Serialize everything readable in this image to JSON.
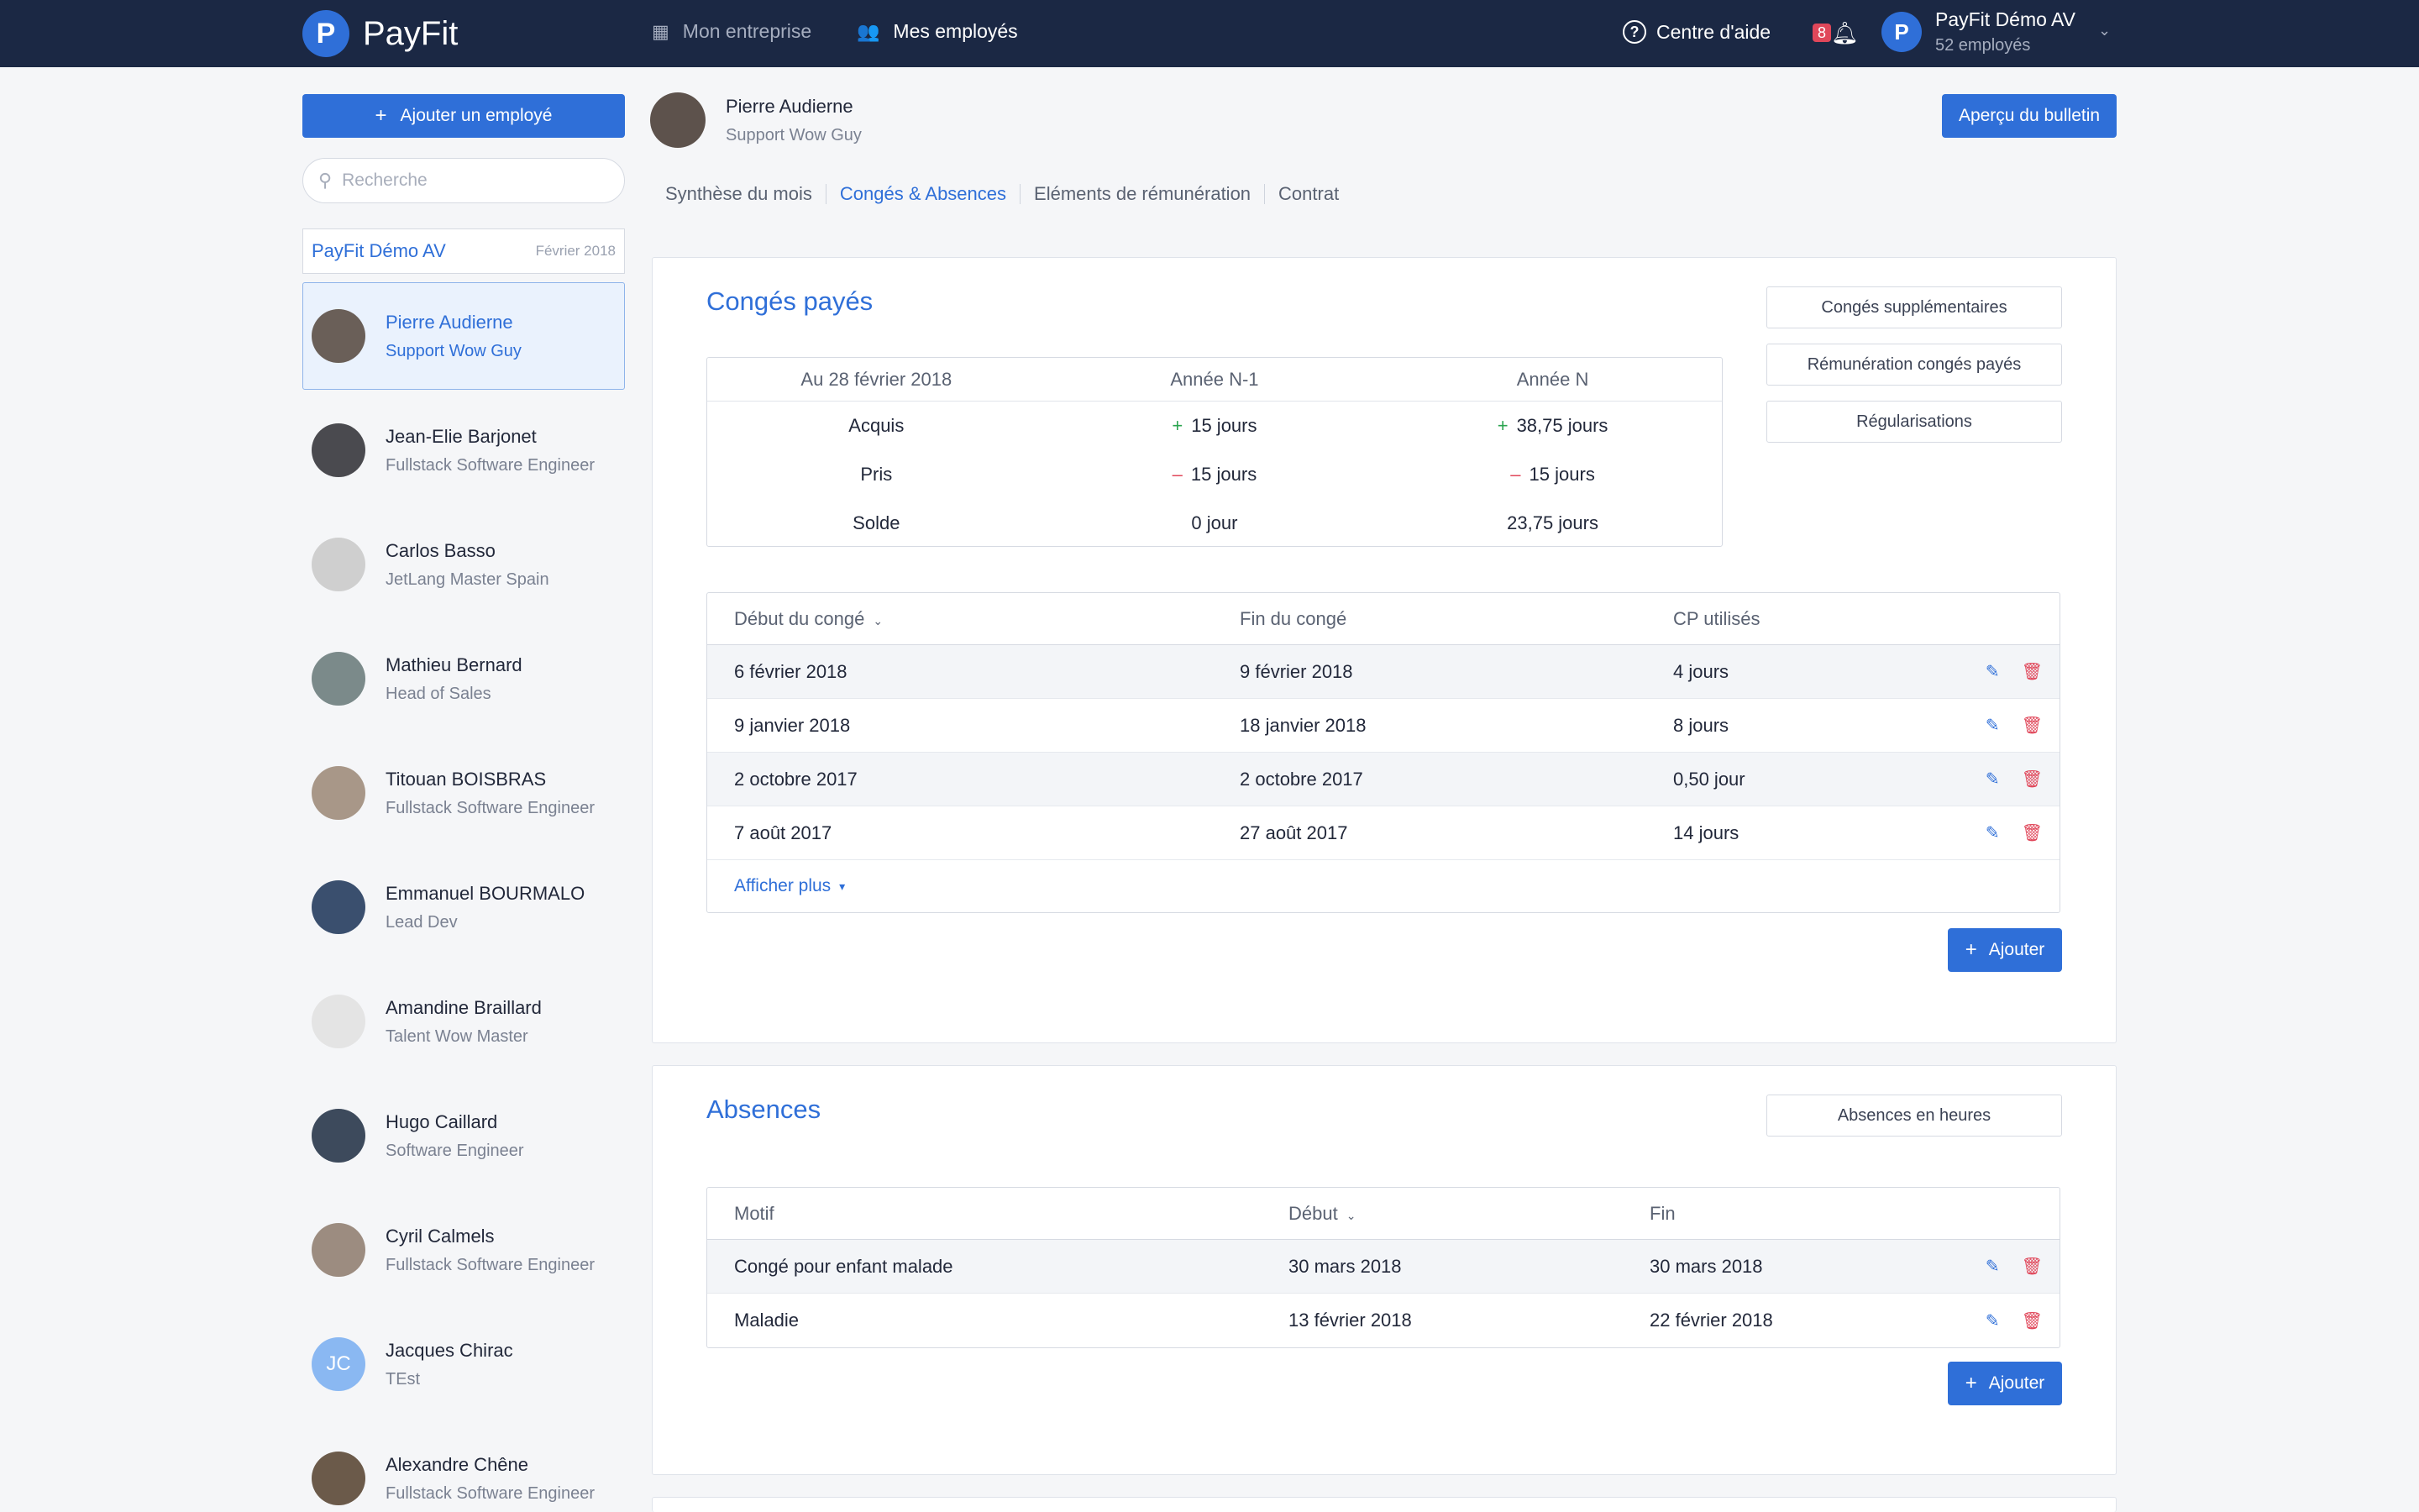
{
  "topbar": {
    "brand": "PayFit",
    "brand_mark": "P",
    "nav": [
      {
        "label": "Mon entreprise",
        "icon": "building-icon"
      },
      {
        "label": "Mes employés",
        "icon": "users-icon"
      }
    ],
    "help_label": "Centre d'aide",
    "notification_count": "8",
    "account_name": "PayFit Démo AV",
    "account_sub": "52 employés"
  },
  "sidebar": {
    "add_employee_label": "Ajouter un employé",
    "search_placeholder": "Recherche",
    "company_name": "PayFit Démo AV",
    "company_period": "Février 2018",
    "employees": [
      {
        "name": "Pierre Audierne",
        "role": "Support Wow Guy",
        "selected": true
      },
      {
        "name": "Jean-Elie Barjonet",
        "role": "Fullstack Software Engineer"
      },
      {
        "name": "Carlos Basso",
        "role": "JetLang Master Spain"
      },
      {
        "name": "Mathieu Bernard",
        "role": "Head of Sales"
      },
      {
        "name": "Titouan BOISBRAS",
        "role": "Fullstack Software Engineer"
      },
      {
        "name": "Emmanuel BOURMALO",
        "role": "Lead Dev"
      },
      {
        "name": "Amandine Braillard",
        "role": "Talent Wow Master"
      },
      {
        "name": "Hugo Caillard",
        "role": "Software Engineer"
      },
      {
        "name": "Cyril Calmels",
        "role": "Fullstack Software Engineer"
      },
      {
        "name": "Jacques Chirac",
        "role": "TEst",
        "initials": "JC"
      },
      {
        "name": "Alexandre Chêne",
        "role": "Fullstack Software Engineer"
      }
    ]
  },
  "employee": {
    "name": "Pierre Audierne",
    "role": "Support Wow Guy",
    "preview_label": "Aperçu du bulletin",
    "tabs": [
      "Synthèse du mois",
      "Congés & Absences",
      "Eléments de rémunération",
      "Contrat"
    ],
    "active_tab": 1
  },
  "conges": {
    "title": "Congés payés",
    "side_buttons": [
      "Congés supplémentaires",
      "Rémunération congés payés",
      "Régularisations"
    ],
    "summary": {
      "headers": [
        "Au 28 février 2018",
        "Année N-1",
        "Année N"
      ],
      "rows": [
        {
          "label": "Acquis",
          "n1": "15 jours",
          "n": "38,75 jours",
          "sign": "+"
        },
        {
          "label": "Pris",
          "n1": "15 jours",
          "n": "15 jours",
          "sign": "–"
        },
        {
          "label": "Solde",
          "n1": "0 jour",
          "n": "23,75 jours",
          "sign": ""
        }
      ]
    },
    "table": {
      "headers": [
        "Début du congé",
        "Fin du congé",
        "CP utilisés"
      ],
      "rows": [
        [
          "6 février 2018",
          "9 février 2018",
          "4 jours"
        ],
        [
          "9 janvier 2018",
          "18 janvier 2018",
          "8 jours"
        ],
        [
          "2 octobre 2017",
          "2 octobre 2017",
          "0,50 jour"
        ],
        [
          "7 août 2017",
          "27 août 2017",
          "14 jours"
        ]
      ],
      "more_label": "Afficher plus"
    },
    "add_label": "Ajouter"
  },
  "absences": {
    "title": "Absences",
    "side_button": "Absences en heures",
    "table": {
      "headers": [
        "Motif",
        "Début",
        "Fin"
      ],
      "rows": [
        [
          "Congé pour enfant malade",
          "30 mars 2018",
          "30 mars 2018"
        ],
        [
          "Maladie",
          "13 février 2018",
          "22 février 2018"
        ]
      ]
    },
    "add_label": "Ajouter"
  },
  "colors": {
    "primary": "#2f6fd8",
    "navbar": "#1b2844",
    "danger": "#e0475a",
    "success": "#2aa44f"
  }
}
